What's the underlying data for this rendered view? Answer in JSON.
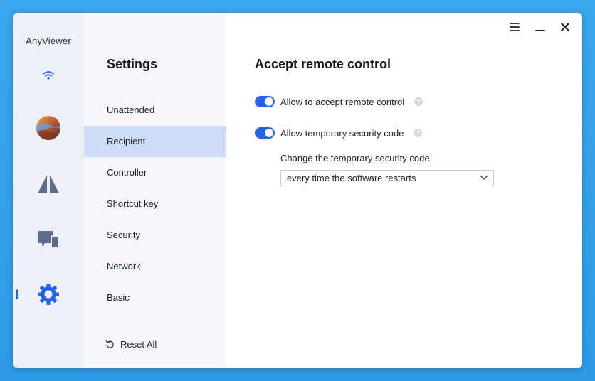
{
  "app": {
    "name": "AnyViewer"
  },
  "rail": {
    "icons": [
      "wifi-icon",
      "avatar",
      "remote-control-icon",
      "devices-icon",
      "gear-icon"
    ]
  },
  "settings": {
    "title": "Settings",
    "items": [
      {
        "label": "Unattended",
        "active": false
      },
      {
        "label": "Recipient",
        "active": true
      },
      {
        "label": "Controller",
        "active": false
      },
      {
        "label": "Shortcut key",
        "active": false
      },
      {
        "label": "Security",
        "active": false
      },
      {
        "label": "Network",
        "active": false
      },
      {
        "label": "Basic",
        "active": false
      }
    ],
    "reset_label": "Reset All"
  },
  "main": {
    "title": "Accept remote control",
    "options": [
      {
        "label": "Allow to accept remote control",
        "enabled": true
      },
      {
        "label": "Allow temporary security code",
        "enabled": true
      }
    ],
    "code_label": "Change the temporary security code",
    "code_select_value": "every time the software restarts"
  },
  "colors": {
    "accent": "#2563eb",
    "active_nav": "#cfdcf7",
    "rail_icon": "#5f6b8a",
    "background": "#3aa6ec"
  }
}
